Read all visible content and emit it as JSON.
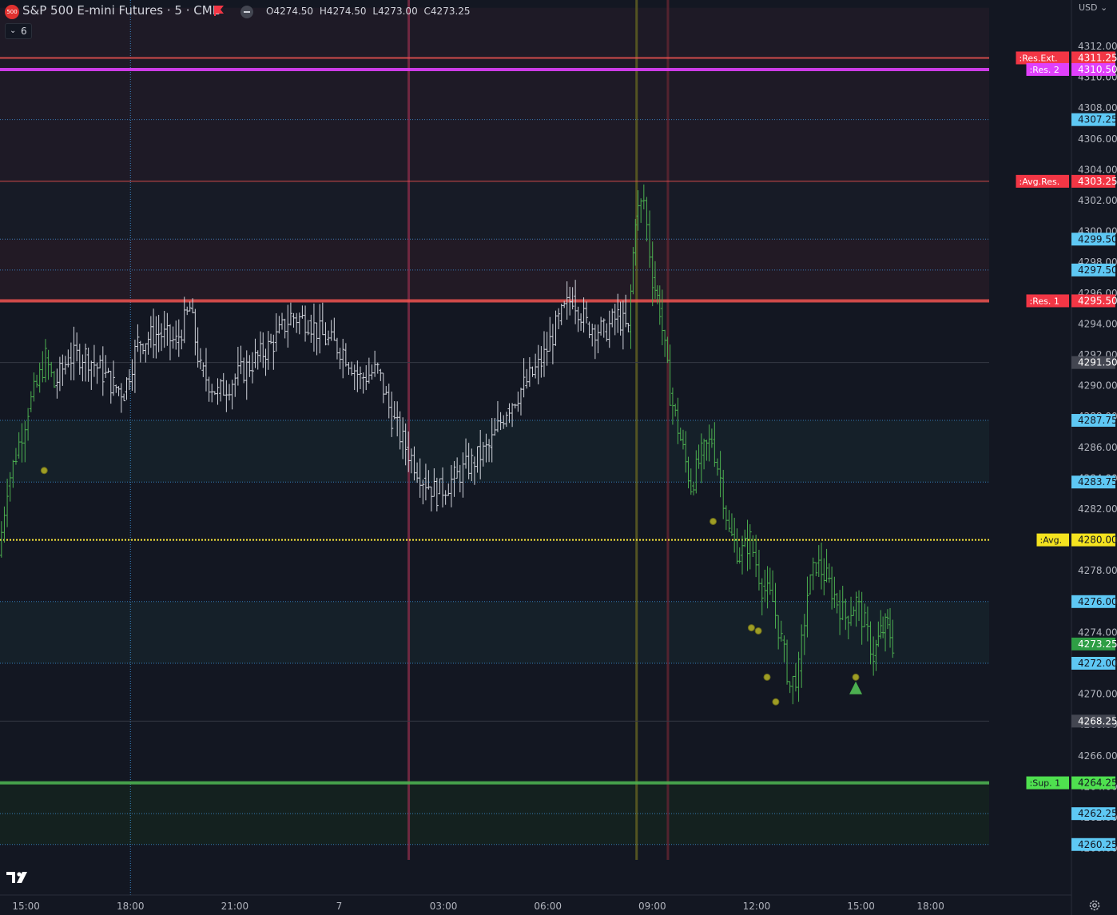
{
  "header": {
    "symbol_badge": "500",
    "title": "S&P 500 E-mini Futures · 5 · CME",
    "open": "O4274.50",
    "high": "H4274.50",
    "low": "L4273.00",
    "close": "C4273.25",
    "indicators_count": "6",
    "currency": "USD"
  },
  "colors": {
    "background": "#131722",
    "candle_white": "#d1d4dc",
    "candle_green": "#4caf50",
    "resistance": "#ef5350",
    "resistance2": "#e040fb",
    "support": "#4caf50",
    "average": "#ffeb3b",
    "zone_line": "#42a5f5"
  },
  "chart_data": {
    "type": "line",
    "title": "S&P 500 E-mini Futures · 5 · CME",
    "ylim": [
      4259.0,
      4314.5
    ],
    "y_ticks": [
      "4312.00",
      "4310.00",
      "4308.00",
      "4306.00",
      "4304.00",
      "4302.00",
      "4300.00",
      "4298.00",
      "4296.00",
      "4294.00",
      "4292.00",
      "4290.00",
      "4288.00",
      "4286.00",
      "4284.00",
      "4282.00",
      "4280.00",
      "4278.00",
      "4276.00",
      "4274.00",
      "4272.00",
      "4270.00",
      "4268.00",
      "4266.00",
      "4264.00",
      "4262.00",
      "4260.00"
    ],
    "x_ticks": [
      {
        "label": "15:00",
        "x": 0.75
      },
      {
        "label": "18:00",
        "x": 3.75
      },
      {
        "label": "21:00",
        "x": 6.75
      },
      {
        "label": "7",
        "x": 9.75
      },
      {
        "label": "03:00",
        "x": 12.75
      },
      {
        "label": "06:00",
        "x": 15.75
      },
      {
        "label": "09:00",
        "x": 18.75
      },
      {
        "label": "12:00",
        "x": 21.75
      },
      {
        "label": "15:00",
        "x": 24.75
      },
      {
        "label": "18:00",
        "x": 26.75
      }
    ],
    "xlim": [
      0.0,
      27.7
    ],
    "last_x": 25.7,
    "levels": [
      {
        "label": ":Res.Ext.",
        "value": "4311.25",
        "y": 4311.25,
        "kind": "res"
      },
      {
        "label": ":Res. 2",
        "value": "4310.50",
        "y": 4310.5,
        "kind": "res2"
      },
      {
        "label": "",
        "value": "4307.25",
        "y": 4307.25,
        "kind": "zone"
      },
      {
        "label": ":Avg.Res.",
        "value": "4303.25",
        "y": 4303.25,
        "kind": "res"
      },
      {
        "label": "",
        "value": "4299.50",
        "y": 4299.5,
        "kind": "zone"
      },
      {
        "label": "",
        "value": "4297.50",
        "y": 4297.5,
        "kind": "zone"
      },
      {
        "label": ":Res. 1",
        "value": "4295.50",
        "y": 4295.5,
        "kind": "res"
      },
      {
        "label": "",
        "value": "4291.50",
        "y": 4291.5,
        "kind": "grey"
      },
      {
        "label": "",
        "value": "4287.75",
        "y": 4287.75,
        "kind": "zone"
      },
      {
        "label": "",
        "value": "4283.75",
        "y": 4283.75,
        "kind": "zone"
      },
      {
        "label": ":Avg.",
        "value": "4280.00",
        "y": 4280.0,
        "kind": "avg"
      },
      {
        "label": "",
        "value": "4276.00",
        "y": 4276.0,
        "kind": "zone"
      },
      {
        "label": "",
        "value": "4273.25",
        "y": 4273.25,
        "kind": "last"
      },
      {
        "label": "",
        "value": "4272.00",
        "y": 4272.0,
        "kind": "zone"
      },
      {
        "label": "",
        "value": "4268.25",
        "y": 4268.25,
        "kind": "grey"
      },
      {
        "label": ":Sup. 1",
        "value": "4264.25",
        "y": 4264.25,
        "kind": "sup"
      },
      {
        "label": "",
        "value": "4262.25",
        "y": 4262.25,
        "kind": "zone"
      },
      {
        "label": "",
        "value": "4260.25",
        "y": 4260.25,
        "kind": "zone"
      }
    ],
    "path_white": [
      [
        1.6,
        4290.0
      ],
      [
        2.0,
        4291.8
      ],
      [
        2.5,
        4292.0
      ],
      [
        3.0,
        4290.8
      ],
      [
        3.3,
        4290.0
      ],
      [
        3.6,
        4289.6
      ],
      [
        4.0,
        4292.8
      ],
      [
        4.6,
        4293.4
      ],
      [
        5.1,
        4292.8
      ],
      [
        5.5,
        4295.0
      ],
      [
        5.8,
        4291.0
      ],
      [
        6.3,
        4289.5
      ],
      [
        6.8,
        4290.5
      ],
      [
        7.3,
        4291.5
      ],
      [
        7.9,
        4292.8
      ],
      [
        8.4,
        4294.5
      ],
      [
        8.9,
        4294.2
      ],
      [
        9.4,
        4293.0
      ],
      [
        9.9,
        4292.3
      ],
      [
        10.4,
        4290.5
      ],
      [
        10.9,
        4291.0
      ],
      [
        11.3,
        4288.0
      ],
      [
        11.7,
        4286.0
      ],
      [
        12.2,
        4284.0
      ],
      [
        12.6,
        4283.0
      ],
      [
        13.1,
        4284.0
      ],
      [
        13.6,
        4285.0
      ],
      [
        14.1,
        4286.0
      ],
      [
        14.6,
        4288.5
      ],
      [
        15.1,
        4290.0
      ],
      [
        15.6,
        4291.5
      ],
      [
        16.1,
        4294.2
      ],
      [
        16.5,
        4295.8
      ],
      [
        16.9,
        4294.0
      ],
      [
        17.4,
        4293.5
      ],
      [
        17.8,
        4294.5
      ],
      [
        18.1,
        4293.5
      ]
    ],
    "path_green": [
      [
        0.0,
        4279.0
      ],
      [
        0.25,
        4283.5
      ],
      [
        0.5,
        4285.5
      ],
      [
        0.85,
        4288.5
      ],
      [
        1.1,
        4290.0
      ],
      [
        1.35,
        4291.8
      ],
      [
        1.6,
        4290.0
      ],
      [
        18.1,
        4293.5
      ],
      [
        18.3,
        4301.0
      ],
      [
        18.55,
        4302.0
      ],
      [
        18.8,
        4297.0
      ],
      [
        19.0,
        4295.0
      ],
      [
        19.3,
        4289.5
      ],
      [
        19.6,
        4286.5
      ],
      [
        19.9,
        4283.5
      ],
      [
        20.2,
        4285.5
      ],
      [
        20.5,
        4286.5
      ],
      [
        20.75,
        4284.0
      ],
      [
        21.0,
        4280.5
      ],
      [
        21.3,
        4279.0
      ],
      [
        21.6,
        4280.0
      ],
      [
        21.95,
        4277.0
      ],
      [
        22.25,
        4276.0
      ],
      [
        22.5,
        4273.5
      ],
      [
        22.75,
        4270.5
      ],
      [
        23.0,
        4271.5
      ],
      [
        23.25,
        4276.5
      ],
      [
        23.5,
        4278.5
      ],
      [
        23.8,
        4277.5
      ],
      [
        24.1,
        4276.0
      ],
      [
        24.35,
        4275.0
      ],
      [
        24.65,
        4276.0
      ],
      [
        24.9,
        4274.5
      ],
      [
        25.15,
        4272.5
      ],
      [
        25.35,
        4274.0
      ],
      [
        25.55,
        4274.5
      ],
      [
        25.7,
        4273.25
      ]
    ],
    "session_lines": [
      {
        "x": 3.75,
        "color": "#42a5f5",
        "dotted": true
      },
      {
        "x": 11.75,
        "color": "#7a2a44",
        "dotted": false
      },
      {
        "x": 18.3,
        "color": "#5a5a22",
        "dotted": false
      },
      {
        "x": 19.2,
        "color": "#5a2430",
        "dotted": false
      }
    ],
    "markers": [
      {
        "x": 1.27,
        "y": 4284.5
      },
      {
        "x": 20.5,
        "y": 4281.2
      },
      {
        "x": 21.6,
        "y": 4274.3
      },
      {
        "x": 21.8,
        "y": 4274.1
      },
      {
        "x": 22.05,
        "y": 4271.1
      },
      {
        "x": 22.3,
        "y": 4269.5
      },
      {
        "x": 24.6,
        "y": 4271.1
      }
    ],
    "arrow": {
      "x": 24.6,
      "y": 4270.3
    }
  }
}
